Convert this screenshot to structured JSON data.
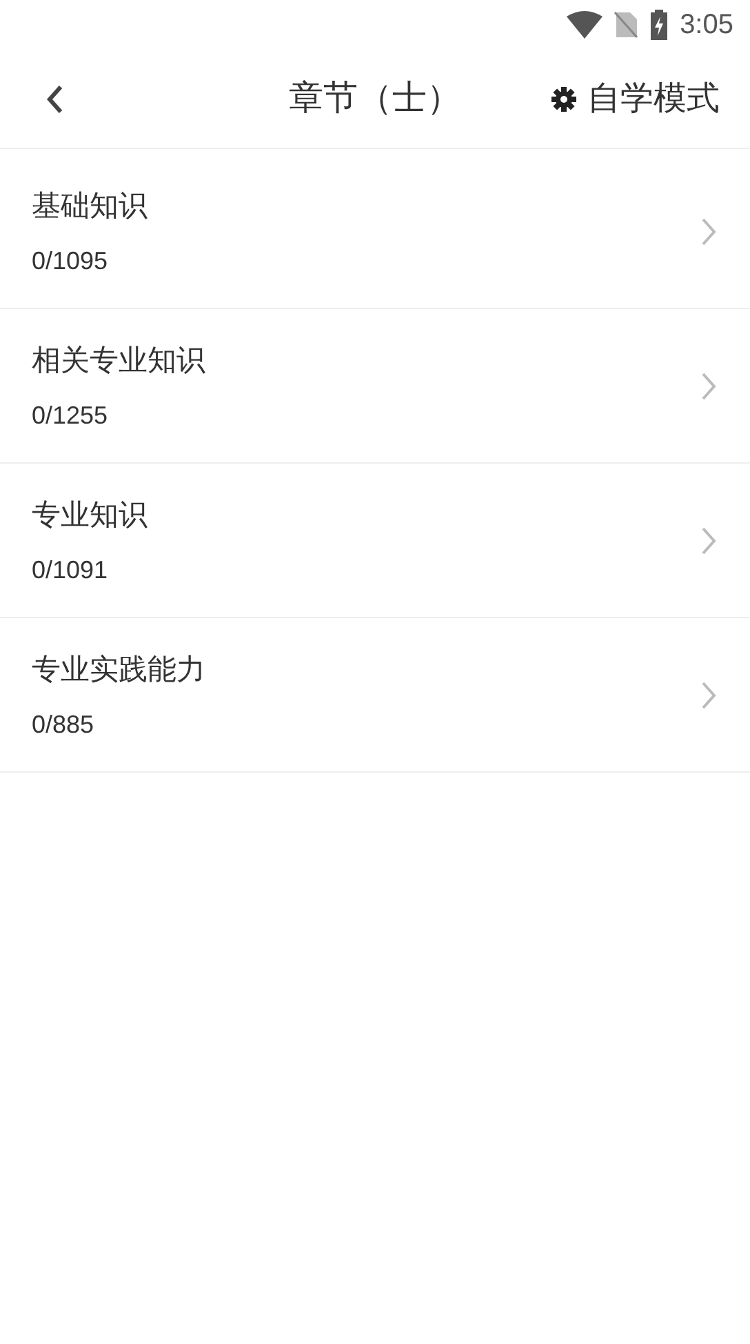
{
  "status_bar": {
    "time": "3:05"
  },
  "header": {
    "title": "章节（士）",
    "action": "自学模式"
  },
  "chapters": [
    {
      "title": "基础知识",
      "progress": "0/1095"
    },
    {
      "title": "相关专业知识",
      "progress": "0/1255"
    },
    {
      "title": "专业知识",
      "progress": "0/1091"
    },
    {
      "title": "专业实践能力",
      "progress": "0/885"
    }
  ]
}
